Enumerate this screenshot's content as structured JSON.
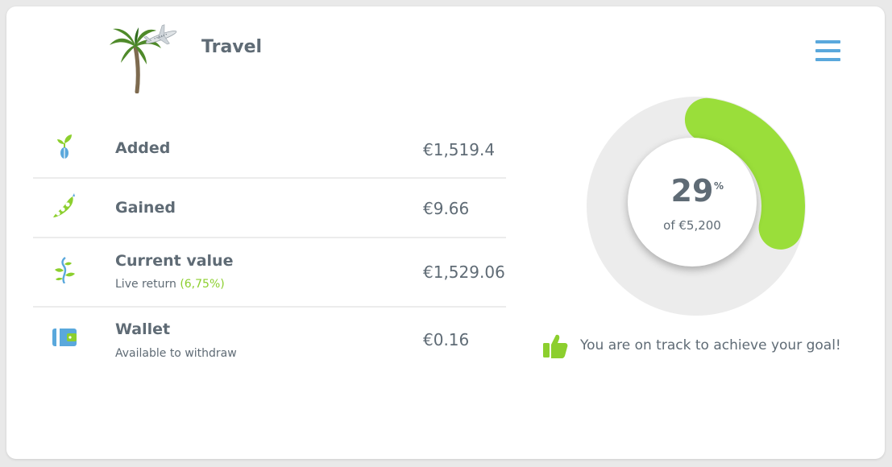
{
  "goal": {
    "title": "Travel",
    "image": "palm-tree-airplane-image"
  },
  "menu": {
    "icon": "hamburger-menu-icon"
  },
  "stats": [
    {
      "icon": "seedling-icon",
      "label": "Added",
      "sub": "",
      "value": "€1,519.4"
    },
    {
      "icon": "pea-pod-icon",
      "label": "Gained",
      "sub": "",
      "value": "€9.66"
    },
    {
      "icon": "growing-vine-icon",
      "label": "Current value",
      "sub": "Live return",
      "sub_highlight": "(6,75%)",
      "value": "€1,529.06"
    },
    {
      "icon": "wallet-icon",
      "label": "Wallet",
      "sub": "Available to withdraw",
      "value": "€0.16"
    }
  ],
  "progress": {
    "percent": 29,
    "percent_sign": "%",
    "target": "of €5,200",
    "status_icon": "thumbs-up-icon",
    "status": "You are on track to achieve your goal!"
  },
  "colors": {
    "accent_green": "#9ade3a",
    "accent_blue": "#5aa8dc",
    "text": "#5f6b75",
    "track": "#ececec"
  }
}
